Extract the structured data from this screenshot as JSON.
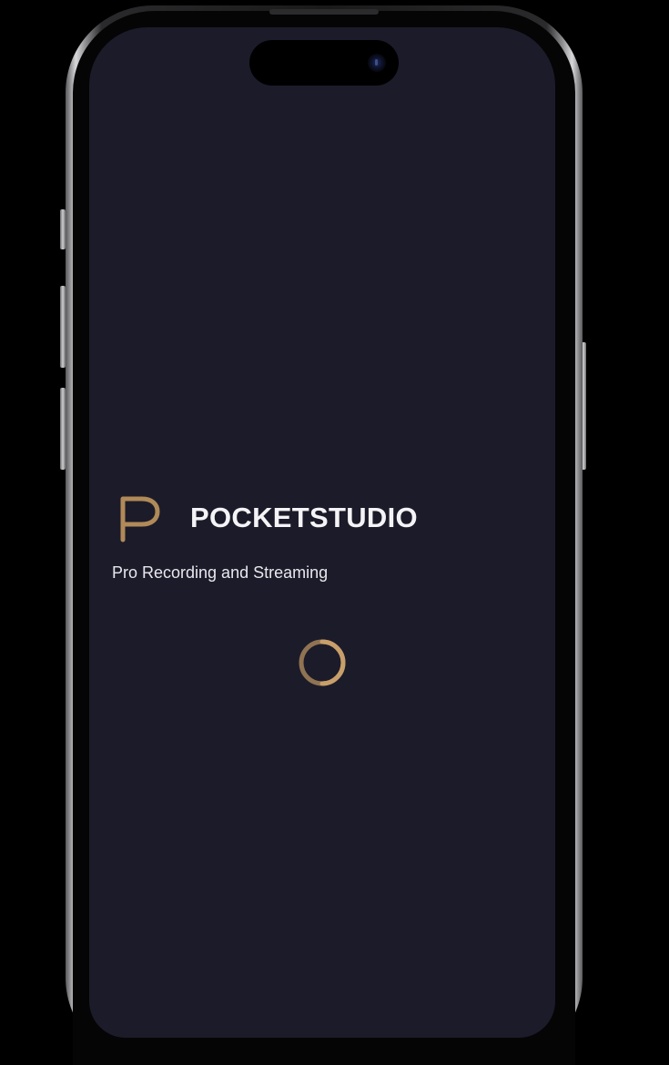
{
  "app": {
    "name": "POCKETSTUDIO",
    "tagline": "Pro Recording and Streaming",
    "logo_icon": "letter-p-logo",
    "loading_icon": "loading-spinner-icon"
  },
  "colors": {
    "screen_background": "#1c1b2a",
    "accent": "#b08a58",
    "text": "#f4f4f6"
  }
}
